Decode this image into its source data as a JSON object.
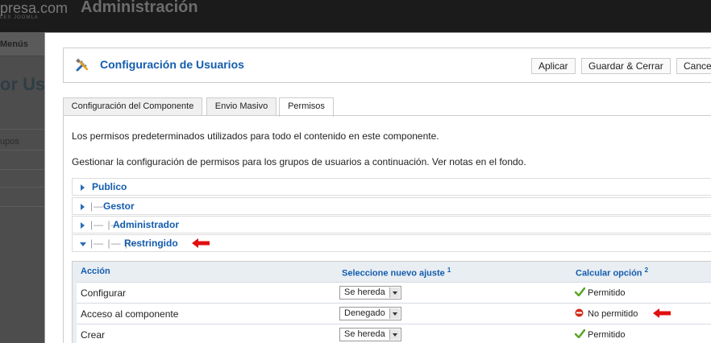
{
  "background": {
    "logo_text": "presa.com",
    "logo_sub": "LES JOOMLA",
    "admin_title": "Administración",
    "nav_label": "Menús",
    "page_heading": "or Usu",
    "grupos_label": "upos"
  },
  "modal": {
    "title": "Configuración de Usuarios",
    "buttons": {
      "apply": "Aplicar",
      "save_close": "Guardar & Cerrar",
      "cancel": "Cancel"
    },
    "tabs": [
      "Configuración del Componente",
      "Envio Masivo",
      "Permisos"
    ],
    "active_tab": "Permisos",
    "desc1": "Los permisos predeterminados utilizados para todo el contenido en este componente.",
    "desc2": "Gestionar la configuración de permisos para los grupos de usuarios a continuación. Ver notas en el fondo.",
    "groups": [
      {
        "name": "Publico",
        "level_marks": "",
        "expanded": false
      },
      {
        "name": "Gestor",
        "level_marks": "|—",
        "expanded": false
      },
      {
        "name": "Administrador",
        "level_marks": "|— |—",
        "expanded": false
      },
      {
        "name": "Restringido",
        "level_marks": "|— |— |—",
        "expanded": true
      }
    ],
    "perm_headers": {
      "action": "Acción",
      "select": "Seleccione nuevo ajuste",
      "select_note": "1",
      "calc": "Calcular opción",
      "calc_note": "2"
    },
    "perm_rows": [
      {
        "action": "Configurar",
        "setting": "Se hereda",
        "calc": "Permitido",
        "status": "allowed"
      },
      {
        "action": "Acceso al componente",
        "setting": "Denegado",
        "calc": "No permitido",
        "status": "denied"
      },
      {
        "action": "Crear",
        "setting": "Se hereda",
        "calc": "Permitido",
        "status": "allowed"
      }
    ]
  },
  "colors": {
    "accent": "#135cae",
    "allowed": "#5ba829",
    "denied": "#d22a1a",
    "annotation": "#e01010"
  },
  "icons": [
    "tools-icon",
    "expand-arrow-icon",
    "collapse-arrow-icon",
    "check-icon",
    "no-entry-icon",
    "red-arrow-annotation"
  ]
}
